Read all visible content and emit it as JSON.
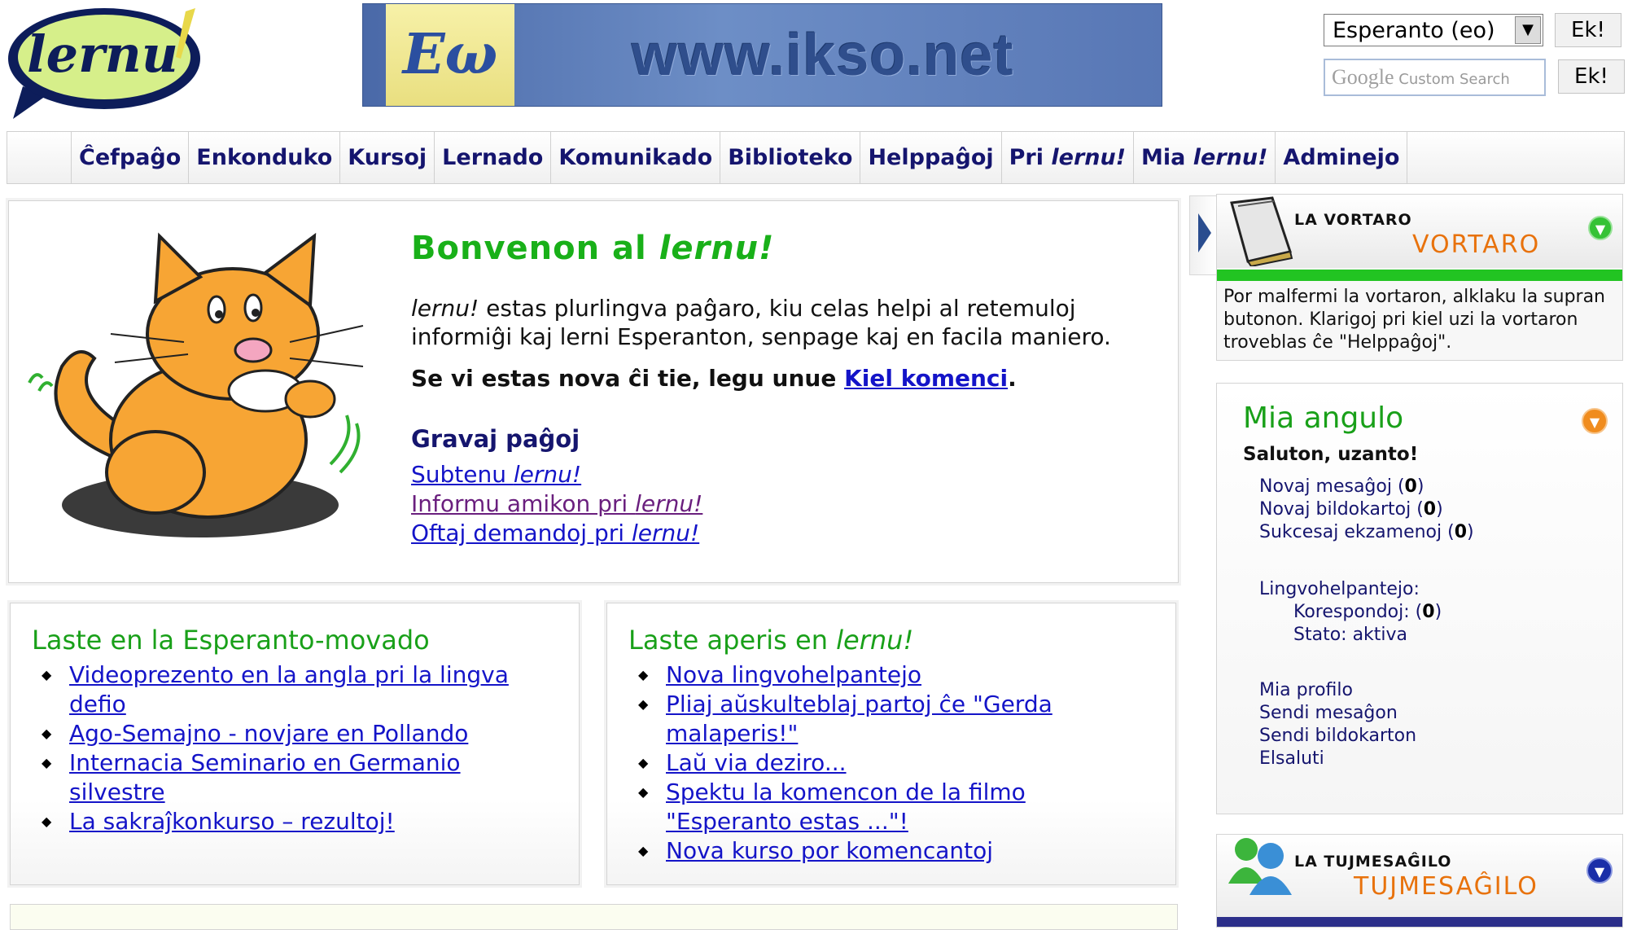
{
  "header": {
    "logo_text": "lernu",
    "banner_emblem": "Eω",
    "banner_url": "www.ikso.net",
    "language_selected": "Esperanto (eo)",
    "go_button_1": "Ek!",
    "go_button_2": "Ek!",
    "search_brand": "Google",
    "search_placeholder": "Custom Search"
  },
  "nav": {
    "items": [
      "Ĉefpaĝo",
      "Enkonduko",
      "Kursoj",
      "Lernado",
      "Komunikado",
      "Biblioteko",
      "Helppaĝoj"
    ],
    "about_prefix": "Pri ",
    "about_brand": "lernu!",
    "mine_prefix": "Mia ",
    "mine_brand": "lernu!",
    "admin": "Adminejo"
  },
  "welcome": {
    "title_prefix": "Bonvenon al ",
    "title_brand": "lernu!",
    "intro_brand": "lernu!",
    "intro_text": " estas plurlingva paĝaro, kiu celas helpi al retemuloj informiĝi kaj lerni Esperanton, senpage kaj en facila maniero.",
    "newcomer_text": "Se vi estas nova ĉi tie, legu unue ",
    "newcomer_link": "Kiel komenci",
    "newcomer_end": ".",
    "important_title": "Gravaj paĝoj",
    "important_links": [
      {
        "text": "Subtenu ",
        "brand": "lernu!"
      },
      {
        "text": "Informu amikon pri ",
        "brand": "lernu!"
      },
      {
        "text": "Oftaj demandoj pri ",
        "brand": "lernu!"
      }
    ]
  },
  "news_movement": {
    "title": "Laste en la Esperanto-movado",
    "items": [
      "Videoprezento en la angla pri la lingva defio",
      "Ago-Semajno - novjare en Pollando",
      "Internacia Seminario en Germanio silvestre",
      "La sakraĵkonkurso – rezultoj!"
    ]
  },
  "news_lernu": {
    "title_prefix": "Laste aperis en ",
    "title_brand": "lernu!",
    "items": [
      "Nova lingvohelpantejo",
      "Pliaj aŭskulteblaj partoj ĉe \"Gerda malaperis!\"",
      "Laŭ via deziro...",
      "Spektu la komencon de la filmo \"Esperanto estas ...\"!",
      "Nova kurso por komencantoj"
    ]
  },
  "dictionary": {
    "label_small": "LA VORTARO",
    "label_big": "VORTARO",
    "description": "Por malfermi la vortaron, alklaku la supran butonon. Klarigoj pri kiel uzi la vortaron troveblas ĉe \"Helppaĝoj\"."
  },
  "my_corner": {
    "title": "Mia angulo",
    "greeting": "Saluton, uzanto!",
    "new_messages": "Novaj mesaĝoj (",
    "new_messages_count": "0",
    "new_cards": "Novaj bildokartoj (",
    "new_cards_count": "0",
    "passed_exams": "Sukcesaj ekzamenoj (",
    "passed_exams_count": "0",
    "close_paren": ")",
    "helper_title": "Lingvohelpantejo:",
    "correspondence": "Korespondoj: (",
    "correspondence_count": "0",
    "status": "Stato: aktiva",
    "links": [
      "Mia profilo",
      "Sendi mesaĝon",
      "Sendi bildokarton",
      "Elsaluti"
    ]
  },
  "messenger": {
    "label_small": "LA TUJMESAĜILO",
    "label_big": "TUJMESAĜILO"
  },
  "colors": {
    "accent_green": "#19b019",
    "nav_text": "#15156e",
    "link": "#1414c8",
    "orange": "#e8720c"
  }
}
